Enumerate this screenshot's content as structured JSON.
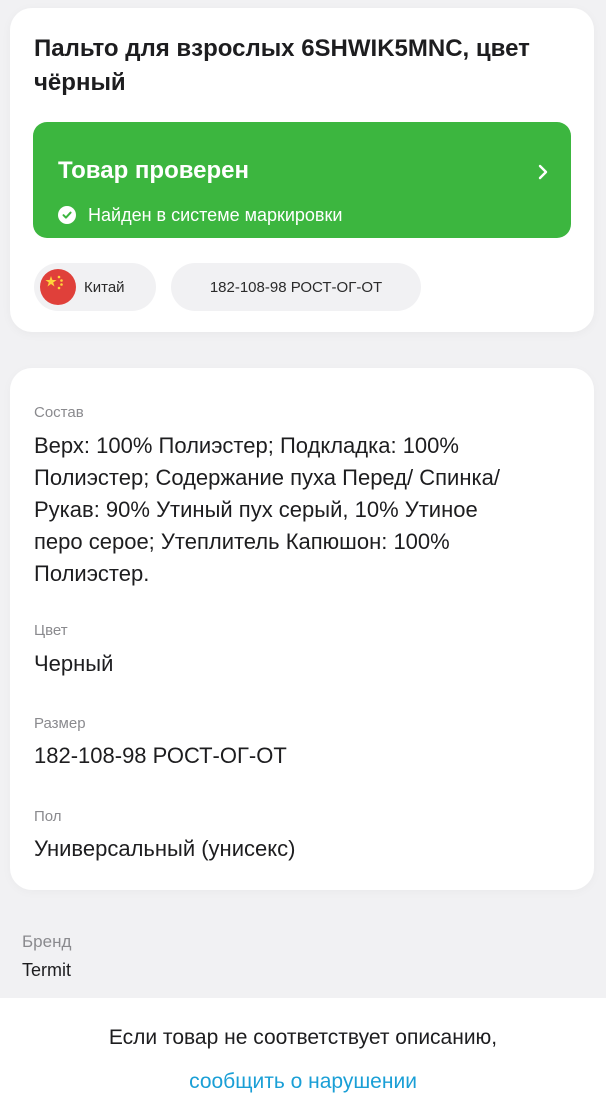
{
  "product": {
    "title": "Пальто для взрослых 6SHWIK5MNC, цвет чёрный"
  },
  "verification": {
    "title": "Товар проверен",
    "subtitle": "Найден в системе маркировки",
    "status_icon": "check-circle-icon",
    "action_icon": "chevron-right-icon",
    "color": "#3cb63f"
  },
  "tags": {
    "country": "Китай",
    "country_flag": "china-flag-icon",
    "model": "182-108-98 РОСТ-ОГ-ОТ"
  },
  "details": {
    "composition_label": "Состав",
    "composition_lines": [
      "Верх: 100% Полиэстер; Подкладка: 100%",
      "Полиэстер; Содержание пуха Перед/ Спинка/",
      "Рукав: 90% Утиный пух серый, 10% Утиное",
      "перо серое; Утеплитель Капюшон: 100%",
      "Полиэстер."
    ],
    "color_label": "Цвет",
    "color_value": "Черный",
    "size_label": "Размер",
    "size_value": "182-108-98 РОСТ-ОГ-ОТ",
    "gender_label": "Пол",
    "gender_value": "Универсальный (унисекс)"
  },
  "brand": {
    "label": "Бренд",
    "value": "Termit"
  },
  "footer": {
    "text": "Если товар не соответствует описанию,",
    "link": "сообщить о нарушении",
    "link_color": "#1a9fd6"
  }
}
